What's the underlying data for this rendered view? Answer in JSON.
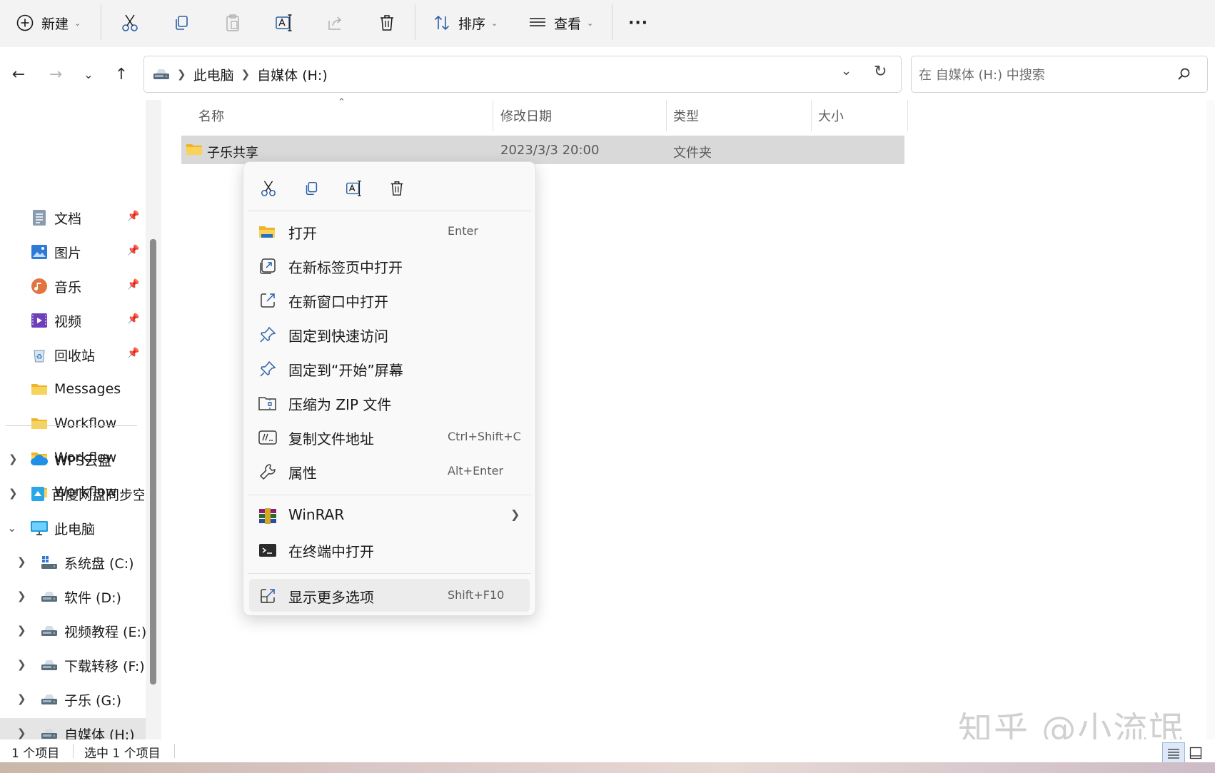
{
  "toolbar": {
    "new_label": "新建",
    "sort_label": "排序",
    "view_label": "查看",
    "more_label": "···"
  },
  "address": {
    "crumbs": [
      "此电脑",
      "自媒体 (H:)"
    ],
    "search_placeholder": "在 自媒体 (H:) 中搜索"
  },
  "sidebar": {
    "quick_access": [
      {
        "label": "文档",
        "icon": "documents-icon"
      },
      {
        "label": "图片",
        "icon": "pictures-icon"
      },
      {
        "label": "音乐",
        "icon": "music-icon"
      },
      {
        "label": "视频",
        "icon": "videos-icon"
      },
      {
        "label": "回收站",
        "icon": "recycle-bin-icon"
      },
      {
        "label": "Messages",
        "icon": "folder-icon"
      },
      {
        "label": "Workflow",
        "icon": "folder-icon"
      },
      {
        "label": "Workflow",
        "icon": "folder-icon"
      },
      {
        "label": "Workflow",
        "icon": "folder-icon"
      }
    ],
    "locations": [
      {
        "label": "WPS云盘",
        "icon": "cloud-icon"
      },
      {
        "label": "百度网盘同步空",
        "icon": "baidu-sync-icon"
      },
      {
        "label": "此电脑",
        "icon": "this-pc-icon"
      }
    ],
    "drives": [
      {
        "label": "系统盘 (C:)"
      },
      {
        "label": "软件 (D:)"
      },
      {
        "label": "视频教程 (E:)"
      },
      {
        "label": "下载转移 (F:)"
      },
      {
        "label": "子乐 (G:)"
      },
      {
        "label": "自媒体 (H:)"
      }
    ]
  },
  "columns": {
    "name": "名称",
    "modified": "修改日期",
    "type": "类型",
    "size": "大小"
  },
  "file": {
    "name": "子乐共享",
    "modified": "2023/3/3 20:00",
    "type": "文件夹"
  },
  "context_menu": {
    "items": [
      {
        "label": "打开",
        "shortcut": "Enter"
      },
      {
        "label": "在新标签页中打开",
        "shortcut": ""
      },
      {
        "label": "在新窗口中打开",
        "shortcut": ""
      },
      {
        "label": "固定到快速访问",
        "shortcut": ""
      },
      {
        "label": "固定到“开始”屏幕",
        "shortcut": ""
      },
      {
        "label": "压缩为 ZIP 文件",
        "shortcut": ""
      },
      {
        "label": "复制文件地址",
        "shortcut": "Ctrl+Shift+C"
      },
      {
        "label": "属性",
        "shortcut": "Alt+Enter"
      },
      {
        "label": "WinRAR",
        "shortcut": ""
      },
      {
        "label": "在终端中打开",
        "shortcut": ""
      },
      {
        "label": "显示更多选项",
        "shortcut": "Shift+F10"
      }
    ]
  },
  "status": {
    "count": "1 个项目",
    "selected": "选中 1 个项目"
  },
  "watermark": "知乎 @小流氓",
  "colors": {
    "accent": "#0067c0",
    "folder": "#f5c542",
    "selection": "#d9d9d9"
  }
}
